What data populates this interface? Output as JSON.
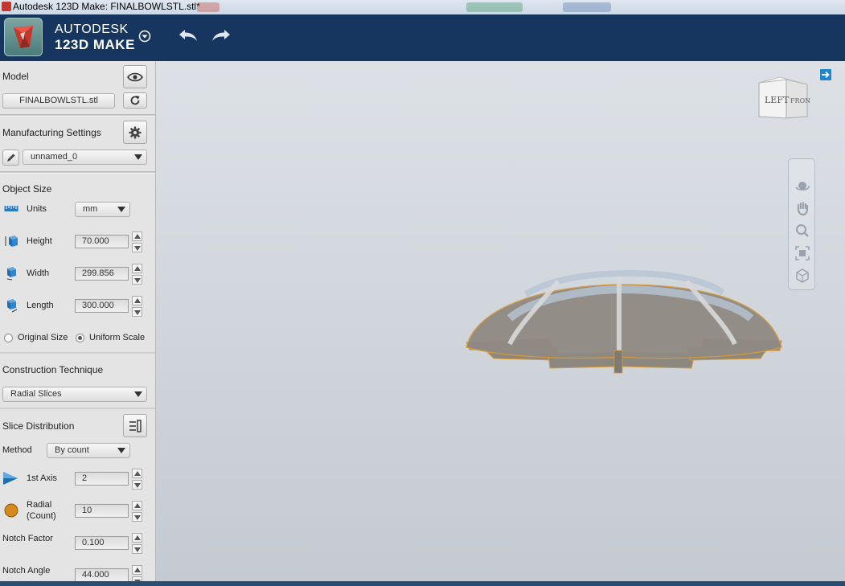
{
  "window": {
    "title": "Autodesk 123D Make: FINALBOWLSTL.stl*"
  },
  "header": {
    "brand_line1": "AUTODESK",
    "brand_line2": "123D MAKE",
    "logo_icon": "autodesk-123d-logo-icon",
    "undo_icon": "undo-icon",
    "redo_icon": "redo-icon"
  },
  "model": {
    "title": "Model",
    "file_button": "FINALBOWLSTL.stl"
  },
  "manufacturing": {
    "title": "Manufacturing Settings",
    "selected": "unnamed_0"
  },
  "object_size": {
    "title": "Object Size",
    "units_label": "Units",
    "units_value": "mm",
    "height_label": "Height",
    "height_value": "70.000",
    "width_label": "Width",
    "width_value": "299.856",
    "length_label": "Length",
    "length_value": "300.000",
    "original_size_label": "Original Size",
    "uniform_scale_label": "Uniform Scale",
    "selected_scale": "Uniform Scale"
  },
  "construction": {
    "title": "Construction Technique",
    "selected": "Radial Slices"
  },
  "slice_distribution": {
    "title": "Slice Distribution",
    "method_label": "Method",
    "method_value": "By count",
    "axis_label": "1st Axis",
    "axis_value": "2",
    "radial_label_1": "Radial",
    "radial_label_2": "(Count)",
    "radial_value": "10",
    "notch_factor_label": "Notch Factor",
    "notch_factor_value": "0.100",
    "notch_angle_label": "Notch Angle",
    "notch_angle_value": "44.000"
  },
  "viewcube": {
    "left_face": "LEFT",
    "front_face": "FRONT"
  },
  "colors": {
    "header_bg": "#16365f",
    "panel_bg": "#e4e4e4",
    "accent": "#1c86d1",
    "model_edge": "#d69a3a"
  }
}
